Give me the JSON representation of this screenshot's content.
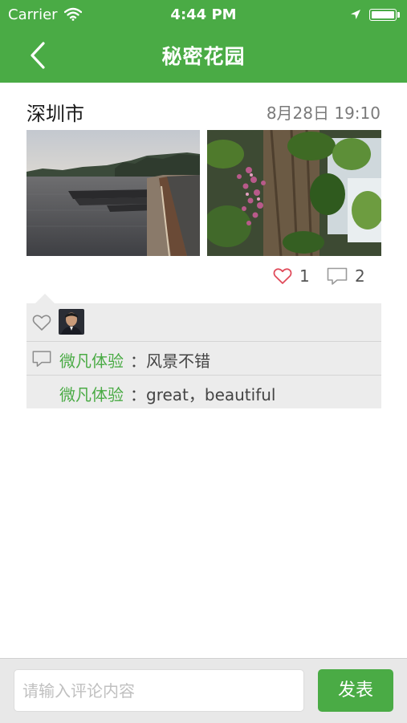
{
  "status_bar": {
    "carrier": "Carrier",
    "time": "4:44 PM"
  },
  "nav": {
    "title": "秘密花园"
  },
  "post": {
    "location": "深圳市",
    "datetime": "8月28日 19:10",
    "likes": "1",
    "comments_count": "2"
  },
  "comments": [
    {
      "author": "微凡体验",
      "text": "：风景不错"
    },
    {
      "author": "微凡体验",
      "text": "：great，beautiful"
    }
  ],
  "composer": {
    "placeholder": "请输入评论内容",
    "send_label": "发表"
  },
  "colors": {
    "brand": "#4aab45",
    "panel": "#ececec"
  }
}
